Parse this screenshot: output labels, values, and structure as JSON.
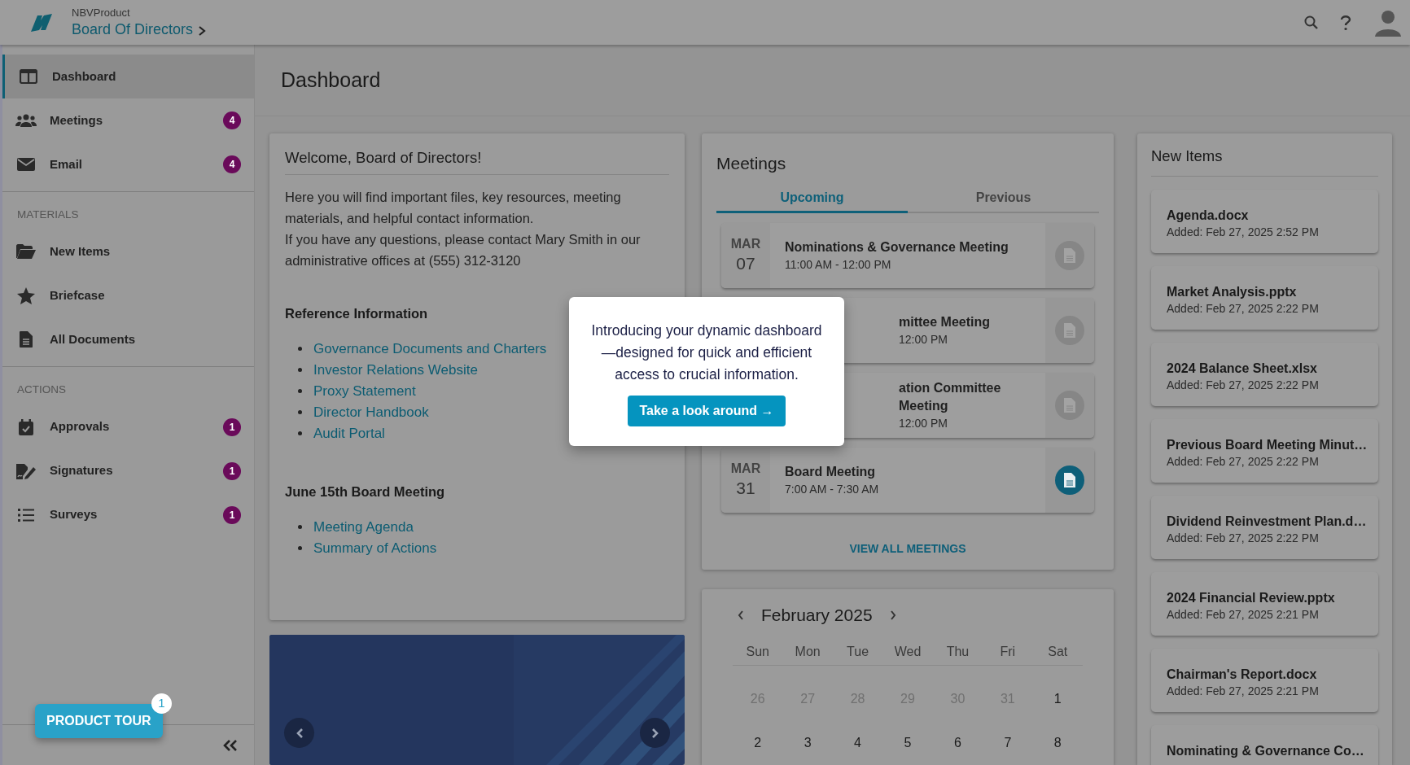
{
  "header": {
    "product": "NBVProduct",
    "title": "Board Of Directors"
  },
  "sidebar": {
    "sections": [
      {
        "items": [
          {
            "label": "Dashboard",
            "selected": true
          },
          {
            "label": "Meetings",
            "badge": "4",
            "selected": false
          },
          {
            "label": "Email",
            "badge": "4",
            "selected": false
          }
        ]
      },
      {
        "heading": "MATERIALS",
        "items": [
          {
            "label": "New Items",
            "selected": false
          },
          {
            "label": "Briefcase",
            "selected": false
          },
          {
            "label": "All Documents",
            "selected": false
          }
        ]
      },
      {
        "heading": "ACTIONS",
        "items": [
          {
            "label": "Approvals",
            "badge": "1",
            "selected": false
          },
          {
            "label": "Signatures",
            "badge": "1",
            "selected": false
          },
          {
            "label": "Surveys",
            "badge": "1",
            "selected": false
          }
        ]
      }
    ],
    "tour": {
      "label": "PRODUCT TOUR",
      "badge": "1"
    }
  },
  "page_title": "Dashboard",
  "welcome": {
    "title": "Welcome, Board of Directors!",
    "intro": [
      "Here you will find important files, key resources, meeting materials, and helpful contact information.",
      "If you have any questions, please contact Mary Smith in our administrative offices at (555) 312-3120"
    ],
    "groups": [
      {
        "heading": "Reference Information",
        "links": [
          "Governance Documents and Charters",
          "Investor Relations Website",
          "Proxy Statement",
          "Director Handbook",
          "Audit Portal"
        ]
      },
      {
        "heading": "June 15th Board Meeting",
        "links": [
          "Meeting Agenda",
          "Summary of Actions"
        ]
      }
    ]
  },
  "meetings": {
    "title": "Meetings",
    "tabs": [
      {
        "label": "Upcoming",
        "selected": true
      },
      {
        "label": "Previous",
        "selected": false
      }
    ],
    "items": [
      {
        "kind": "full",
        "month": "MAR",
        "day": "07",
        "title": "Nominations & Governance Meeting",
        "time": "11:00 AM - 12:00 PM",
        "disabled": true
      },
      {
        "kind": "cut",
        "title": "mittee Meeting",
        "time": "12:00 PM",
        "disabled": true
      },
      {
        "kind": "cut",
        "title": "ation Committee Meeting",
        "time": "12:00 PM",
        "disabled": true
      },
      {
        "kind": "full",
        "month": "MAR",
        "day": "31",
        "title": "Board Meeting",
        "time": "7:00 AM - 7:30 AM",
        "disabled": false
      }
    ],
    "view_all": "VIEW ALL MEETINGS"
  },
  "calendar": {
    "month": "February 2025",
    "weekdays": [
      "Sun",
      "Mon",
      "Tue",
      "Wed",
      "Thu",
      "Fri",
      "Sat"
    ],
    "weeks": [
      [
        {
          "day": "26",
          "outside": true
        },
        {
          "day": "27",
          "outside": true
        },
        {
          "day": "28",
          "outside": true
        },
        {
          "day": "29",
          "outside": true
        },
        {
          "day": "30",
          "outside": true
        },
        {
          "day": "31",
          "outside": true
        },
        {
          "day": "1",
          "outside": false
        }
      ],
      [
        {
          "day": "2",
          "outside": false
        },
        {
          "day": "3",
          "outside": false
        },
        {
          "day": "4",
          "outside": false
        },
        {
          "day": "5",
          "outside": false
        },
        {
          "day": "6",
          "outside": false
        },
        {
          "day": "7",
          "outside": false
        },
        {
          "day": "8",
          "outside": false
        }
      ]
    ]
  },
  "new_items": {
    "title": "New Items",
    "items": [
      {
        "name": "Agenda.docx",
        "added": "Added: Feb 27, 2025 2:52 PM"
      },
      {
        "name": "Market Analysis.pptx",
        "added": "Added: Feb 27, 2025 2:22 PM"
      },
      {
        "name": "2024 Balance Sheet.xlsx",
        "added": "Added: Feb 27, 2025 2:22 PM"
      },
      {
        "name": "Previous Board Meeting Minut…",
        "added": "Added: Feb 27, 2025 2:22 PM"
      },
      {
        "name": "Dividend Reinvestment Plan.d…",
        "added": "Added: Feb 27, 2025 2:22 PM"
      },
      {
        "name": "2024 Financial Review.pptx",
        "added": "Added: Feb 27, 2025 2:21 PM"
      },
      {
        "name": "Chairman's Report.docx",
        "added": "Added: Feb 27, 2025 2:21 PM"
      },
      {
        "name": "Nominating & Governance Co…"
      }
    ]
  },
  "popover": {
    "text": "Introducing your dynamic dashboard—designed for quick and efficient access to crucial information.",
    "button": "Take a look around →"
  }
}
